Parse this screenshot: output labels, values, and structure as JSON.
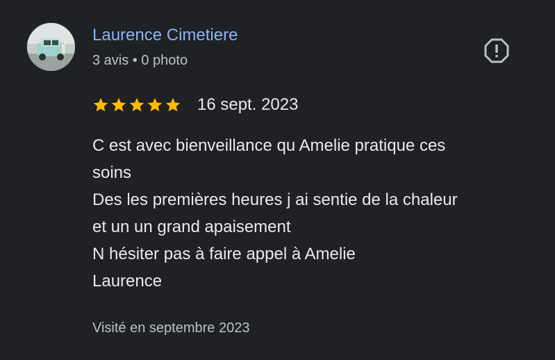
{
  "author": {
    "name": "Laurence Cimetiere",
    "meta": "3 avis • 0 photo"
  },
  "review": {
    "rating": 5,
    "max_rating": 5,
    "date": "16 sept. 2023",
    "lines": [
      "C est avec bienveillance qu Amelie pratique ces",
      "soins",
      "Des les premières heures j ai sentie de la chaleur",
      "et un un grand apaisement",
      "N hésiter pas à faire appel à Amelie",
      "Laurence"
    ],
    "visited": "Visité en septembre 2023"
  },
  "icons": {
    "report": "report-flag-icon",
    "star": "star-icon"
  },
  "colors": {
    "background": "#202124",
    "name": "#8ab4f8",
    "star": "#fbbc04",
    "text": "#e8eaed",
    "secondary_text": "#bdc1c6"
  }
}
